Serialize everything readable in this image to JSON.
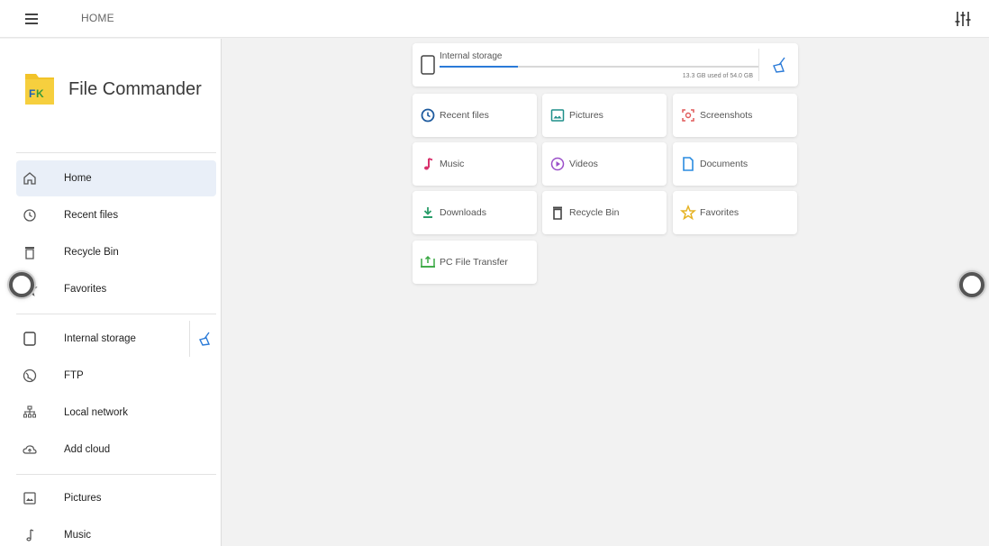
{
  "header": {
    "title": "HOME"
  },
  "sidebar": {
    "app_name": "File Commander",
    "logo_text": "FC",
    "items": [
      {
        "label": "Home"
      },
      {
        "label": "Recent files"
      },
      {
        "label": "Recycle Bin"
      },
      {
        "label": "Favorites"
      },
      {
        "label": "Internal storage"
      },
      {
        "label": "FTP"
      },
      {
        "label": "Local network"
      },
      {
        "label": "Add cloud"
      },
      {
        "label": "Pictures"
      },
      {
        "label": "Music"
      }
    ]
  },
  "storage": {
    "title": "Internal storage",
    "usage_text": "13.3 GB used of 54.0 GB",
    "used_fraction": 0.246
  },
  "tiles": [
    {
      "label": "Recent files"
    },
    {
      "label": "Pictures"
    },
    {
      "label": "Screenshots"
    },
    {
      "label": "Music"
    },
    {
      "label": "Videos"
    },
    {
      "label": "Documents"
    },
    {
      "label": "Downloads"
    },
    {
      "label": "Recycle Bin"
    },
    {
      "label": "Favorites"
    },
    {
      "label": "PC File Transfer"
    }
  ],
  "colors": {
    "accent": "#2a7ad8",
    "active_bg": "#e9eff8",
    "logo_yellow": "#f2c329",
    "music_pink": "#d8326d",
    "pictures_teal": "#1f8f8a",
    "screenshots_red": "#e05a5a",
    "videos_purple": "#9b4fc9",
    "documents_blue": "#2a8be0",
    "downloads_green": "#2a9d6a",
    "favorites_yellow": "#e6b325",
    "pc_transfer_green": "#3aa843"
  }
}
